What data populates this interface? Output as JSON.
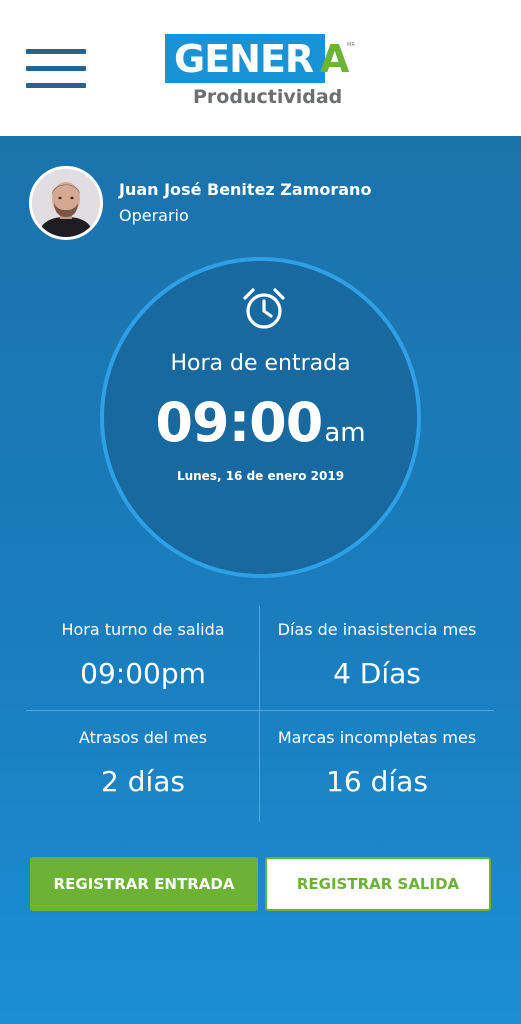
{
  "header": {
    "logo_main": "GENER",
    "logo_accent": "A",
    "logo_mark": "MR",
    "logo_subtitle": "Productividad"
  },
  "user": {
    "name": "Juan José Benitez Zamorano",
    "role": "Operario"
  },
  "clock": {
    "label": "Hora de entrada",
    "time": "09:00",
    "period": "am",
    "date": "Lunes, 16 de enero 2019"
  },
  "stats": [
    {
      "label": "Hora turno de salida",
      "value": "09:00pm"
    },
    {
      "label": "Días de inasistencia mes",
      "value": "4 Días"
    },
    {
      "label": "Atrasos del mes",
      "value": "2 días"
    },
    {
      "label": "Marcas incompletas mes",
      "value": "16 días"
    }
  ],
  "actions": {
    "check_in": "REGISTRAR ENTRADA",
    "check_out": "REGISTRAR SALIDA"
  },
  "colors": {
    "brand_blue": "#1a93d6",
    "brand_green": "#6cb234",
    "menu_icon": "#24638c",
    "background": "#1a7dbd"
  },
  "icons": {
    "menu": "hamburger-menu-icon",
    "alarm": "alarm-clock-icon"
  }
}
